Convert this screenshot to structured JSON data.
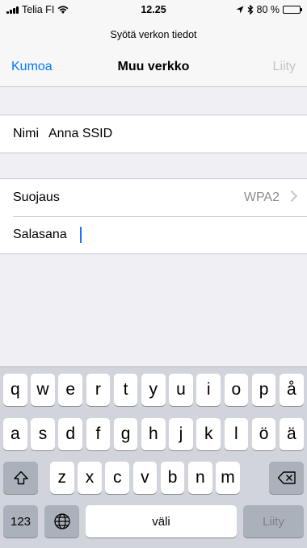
{
  "status_bar": {
    "carrier": "Telia FI",
    "time": "12.25",
    "battery": "80 %",
    "battery_level": 0.8,
    "icons": [
      "signal-icon",
      "wifi-icon",
      "location-icon",
      "bluetooth-icon",
      "battery-icon"
    ]
  },
  "nav": {
    "prompt": "Syötä verkon tiedot",
    "cancel_label": "Kumoa",
    "title": "Muu verkko",
    "join_label": "Liity"
  },
  "form": {
    "name_label": "Nimi",
    "name_placeholder": "Anna SSID",
    "security_label": "Suojaus",
    "security_value": "WPA2",
    "password_label": "Salasana",
    "password_value": ""
  },
  "keyboard": {
    "row1": [
      "q",
      "w",
      "e",
      "r",
      "t",
      "y",
      "u",
      "i",
      "o",
      "p",
      "å"
    ],
    "row2": [
      "a",
      "s",
      "d",
      "f",
      "g",
      "h",
      "j",
      "k",
      "l",
      "ö",
      "ä"
    ],
    "row3": [
      "z",
      "x",
      "c",
      "v",
      "b",
      "n",
      "m"
    ],
    "numbers_label": "123",
    "space_label": "väli",
    "return_label": "Liity"
  },
  "colors": {
    "accent": "#007aff",
    "disabled": "#c4c4c7",
    "keyboard_bg": "#d1d4da",
    "caret": "#1a73ff"
  }
}
